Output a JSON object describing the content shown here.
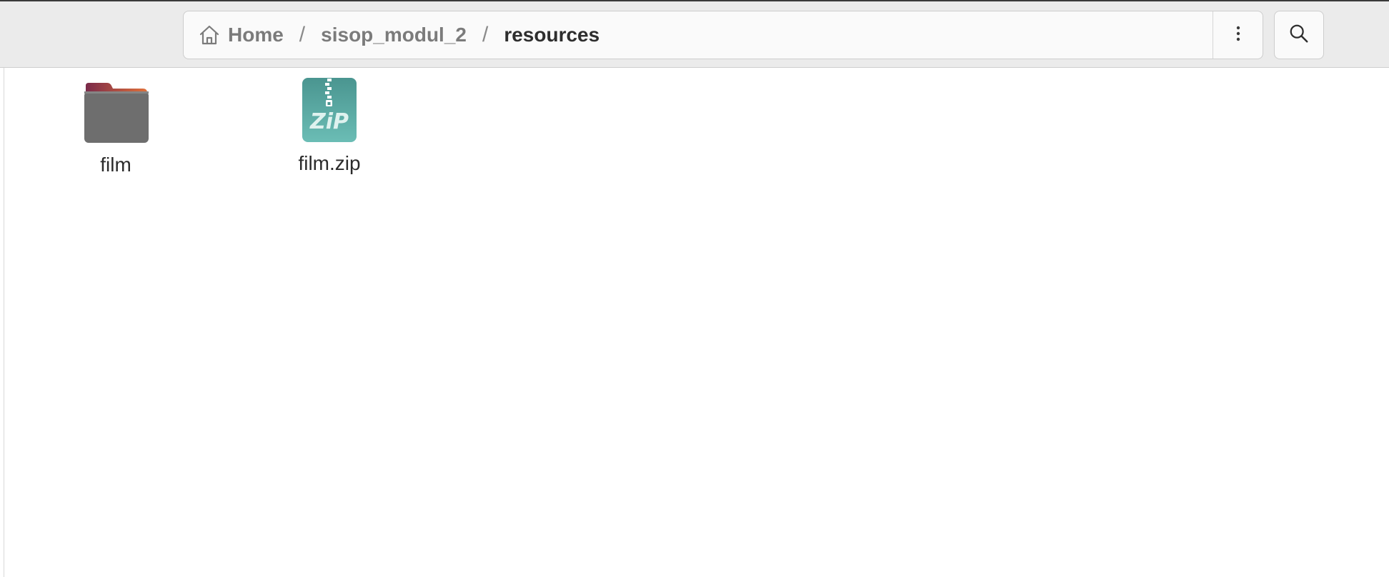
{
  "breadcrumb": {
    "items": [
      {
        "label": "Home",
        "icon": "home-icon"
      },
      {
        "label": "sisop_modul_2"
      },
      {
        "label": "resources"
      }
    ],
    "separator": "/"
  },
  "toolbar": {
    "menu_icon": "vertical-ellipsis-icon",
    "search_icon": "search-icon"
  },
  "files": [
    {
      "name": "film",
      "type": "folder",
      "icon": "folder-icon"
    },
    {
      "name": "film.zip",
      "type": "archive",
      "icon": "zip-archive-icon",
      "icon_text": "ZiP"
    }
  ],
  "colors": {
    "folder_body": "#6e6e6e",
    "folder_tab_start": "#7a2a4a",
    "folder_tab_end": "#e0703a",
    "zip_bg": "#5aa8a0",
    "headerbar": "#ebebeb"
  }
}
